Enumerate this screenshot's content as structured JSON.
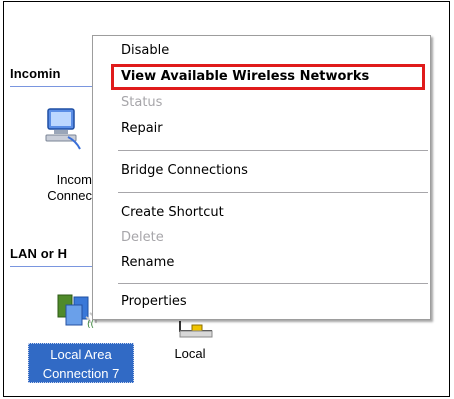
{
  "background": {
    "sections": [
      {
        "header": "Incomin"
      },
      {
        "header": "LAN or H"
      }
    ],
    "incoming_connection": {
      "label_line1": "Incom",
      "label_line2": "Connec"
    },
    "lan_items": [
      {
        "label_line1": "Local Area",
        "label_line2": "Connection 7",
        "selected": true
      },
      {
        "label_line1": "Local",
        "selected": false
      }
    ]
  },
  "context_menu": {
    "items": [
      {
        "label": "Disable",
        "state": "enabled"
      },
      {
        "label": "View Available Wireless Networks",
        "state": "default",
        "highlighted": true
      },
      {
        "label": "Status",
        "state": "disabled"
      },
      {
        "label": "Repair",
        "state": "enabled"
      },
      {
        "label": "Bridge Connections",
        "state": "enabled"
      },
      {
        "label": "Create Shortcut",
        "state": "enabled"
      },
      {
        "label": "Delete",
        "state": "disabled"
      },
      {
        "label": "Rename",
        "state": "enabled"
      },
      {
        "label": "Properties",
        "state": "enabled"
      }
    ],
    "highlight_color": "#e01b1b"
  },
  "colors": {
    "selection": "#316ac5",
    "section_line": "#7a96df",
    "disabled_text": "#a7a6aa"
  },
  "icons": {
    "incoming": "incoming-connection-icon",
    "lan_wireless": "wireless-network-connection-icon",
    "lan_local": "local-area-connection-icon"
  }
}
